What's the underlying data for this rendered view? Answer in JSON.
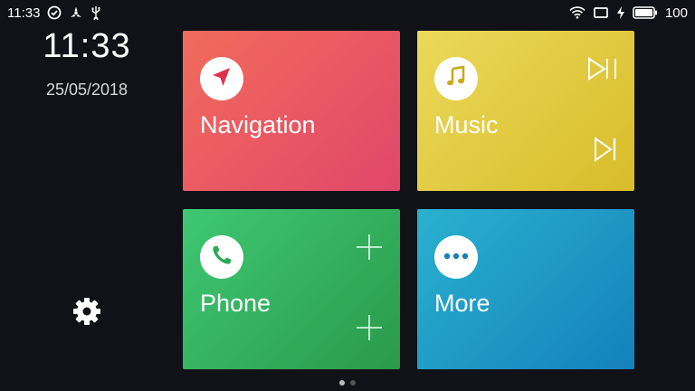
{
  "status_bar": {
    "time": "11:33",
    "battery": "100",
    "icons_left": [
      "check-circle-icon",
      "fan-icon",
      "usb-icon"
    ],
    "icons_right": [
      "wifi-icon",
      "screen-cast-icon",
      "charging-icon",
      "battery-icon"
    ]
  },
  "sidebar": {
    "clock": "11:33",
    "date": "25/05/2018",
    "settings_icon": "gear-icon"
  },
  "tiles": [
    {
      "label": "Navigation",
      "icon": "navigation-arrow-icon",
      "color": "#e95864"
    },
    {
      "label": "Music",
      "icon": "music-note-icon",
      "color": "#e2cc42",
      "actions": [
        "play-pause-icon",
        "skip-next-icon"
      ]
    },
    {
      "label": "Phone",
      "icon": "phone-icon",
      "color": "#34b05f",
      "actions": [
        "add-icon",
        "add-icon"
      ]
    },
    {
      "label": "More",
      "icon": "more-dots-icon",
      "color": "#1f9ac6"
    }
  ],
  "pager": {
    "pages": 2,
    "current": 1
  }
}
